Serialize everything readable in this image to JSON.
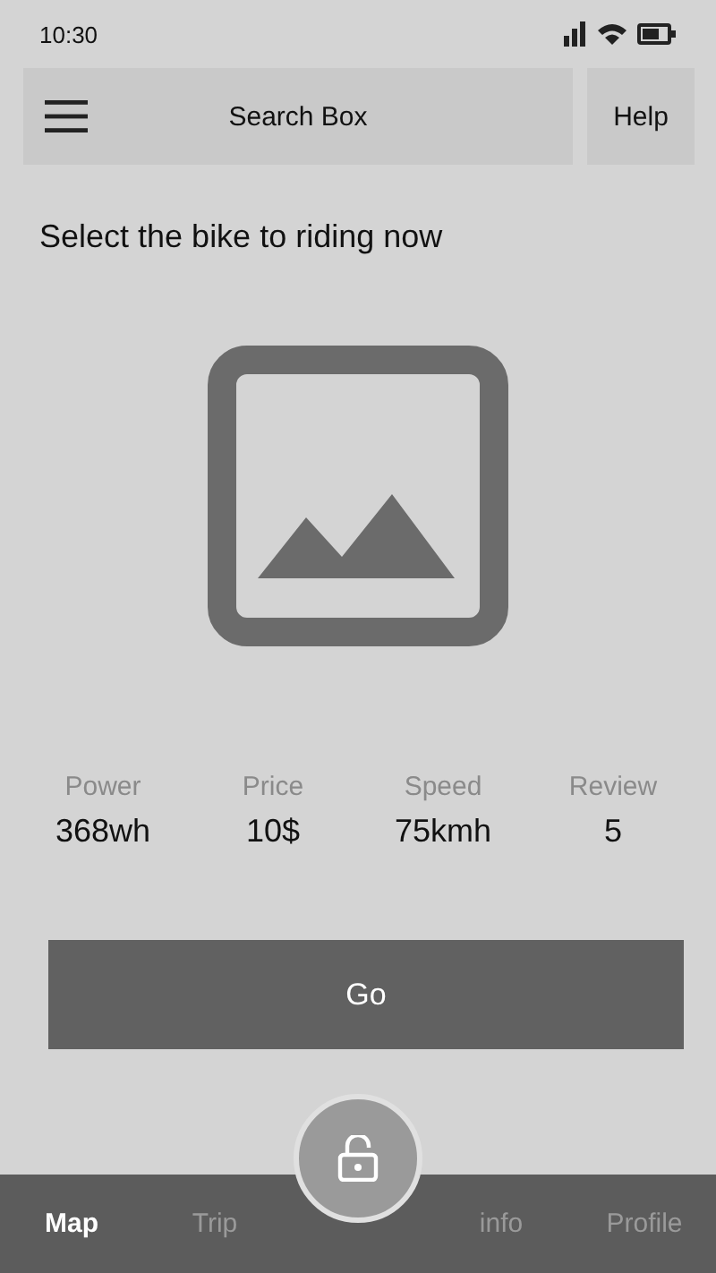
{
  "status_bar": {
    "time": "10:30"
  },
  "top_bar": {
    "search": {
      "placeholder": "Search Box"
    },
    "help_button": "Help"
  },
  "title": "Select the bike to riding now",
  "stats": [
    {
      "label": "Power",
      "value": "368wh"
    },
    {
      "label": "Price",
      "value": "10$"
    },
    {
      "label": "Speed",
      "value": "75kmh"
    },
    {
      "label": "Review",
      "value": "5"
    }
  ],
  "go_button": "Go",
  "bottom_nav": [
    {
      "label": "Map",
      "selected": true
    },
    {
      "label": "Trip",
      "selected": false
    },
    {
      "label": "info",
      "selected": false
    },
    {
      "label": "Profile",
      "selected": false
    }
  ]
}
